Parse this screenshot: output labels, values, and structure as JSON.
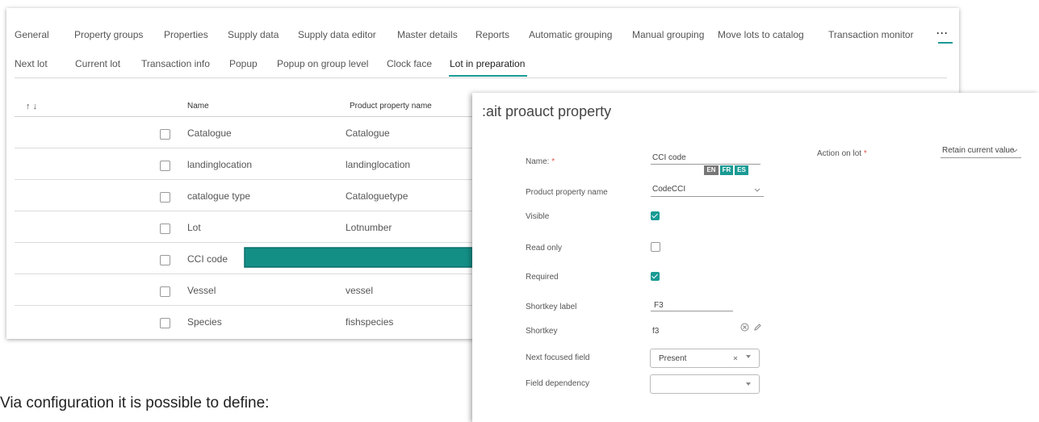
{
  "top_tabs": [
    "General",
    "Property groups",
    "Properties",
    "Supply data",
    "Supply data editor",
    "Master details",
    "Reports",
    "Automatic grouping",
    "Manual grouping",
    "Move lots to catalog",
    "Transaction monitor",
    "···"
  ],
  "sub_tabs": [
    "Next lot",
    "Current lot",
    "Transaction info",
    "Popup",
    "Popup on group level",
    "Clock face",
    "Lot in preparation"
  ],
  "sub_tabs_active": "Lot in preparation",
  "table": {
    "sort_icon": "↑ ↓",
    "columns": [
      "Name",
      "Product property name"
    ],
    "rows": [
      {
        "name": "Catalogue",
        "property": "Catalogue"
      },
      {
        "name": "landinglocation",
        "property": "landinglocation"
      },
      {
        "name": "catalogue type",
        "property": "Cataloguetype"
      },
      {
        "name": "Lot",
        "property": "Lotnumber"
      },
      {
        "name": "CCI code",
        "property": ""
      },
      {
        "name": "Vessel",
        "property": "vessel"
      },
      {
        "name": "Species",
        "property": "fishspecies"
      }
    ]
  },
  "dialog": {
    "title": ":ait proauct property",
    "name_label": "Name:",
    "name_value": "CCI code",
    "langs": [
      "EN",
      "FR",
      "ES"
    ],
    "action_label": "Action on lot",
    "action_value": "Retain current value",
    "product_property_label": "Product property name",
    "product_property_value": "CodeCCI",
    "visible_label": "Visible",
    "visible_checked": true,
    "readonly_label": "Read only",
    "readonly_checked": false,
    "required_label": "Required",
    "required_checked": true,
    "shortkey_label_label": "Shortkey label",
    "shortkey_label_value": "F3",
    "shortkey_label": "Shortkey",
    "shortkey_value": "f3",
    "next_field_label": "Next focused field",
    "next_field_value": "Present",
    "field_dependency_label": "Field dependency",
    "field_dependency_value": "",
    "required_marker": "*"
  },
  "caption": "Via configuration it is possible to define:",
  "colors": {
    "accent": "#1a9b94",
    "lang_en": "#777777",
    "required": "#e0534a"
  }
}
